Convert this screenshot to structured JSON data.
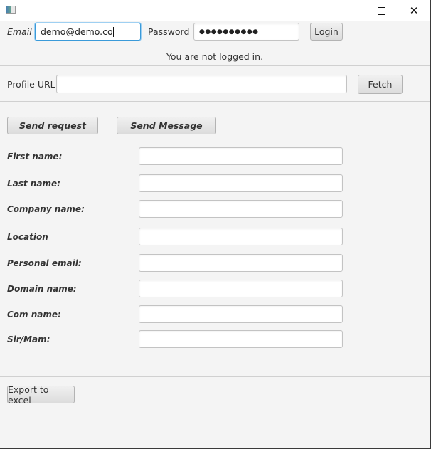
{
  "window": {
    "icon": "app-icon",
    "controls": {
      "minimize": "minimize-icon",
      "maximize": "maximize-icon",
      "close": "close-icon"
    }
  },
  "login": {
    "email_label": "Email",
    "email_value": "demo@demo.co",
    "password_label": "Password",
    "password_value": "●●●●●●●●●●",
    "login_button": "Login",
    "status": "You are not logged in."
  },
  "profile": {
    "url_label": "Profile URL",
    "url_value": "",
    "fetch_button": "Fetch"
  },
  "actions": {
    "send_request": "Send request",
    "send_message": "Send Message"
  },
  "form": {
    "fields": [
      {
        "label": "First name:",
        "value": ""
      },
      {
        "label": "Last name:",
        "value": ""
      },
      {
        "label": "Company name:",
        "value": ""
      },
      {
        "label": "Location",
        "value": ""
      },
      {
        "label": "Personal email:",
        "value": ""
      },
      {
        "label": "Domain name:",
        "value": ""
      },
      {
        "label": "Com name:",
        "value": ""
      },
      {
        "label": "Sir/Mam:",
        "value": ""
      }
    ]
  },
  "footer": {
    "export_button": "Export to excel"
  }
}
